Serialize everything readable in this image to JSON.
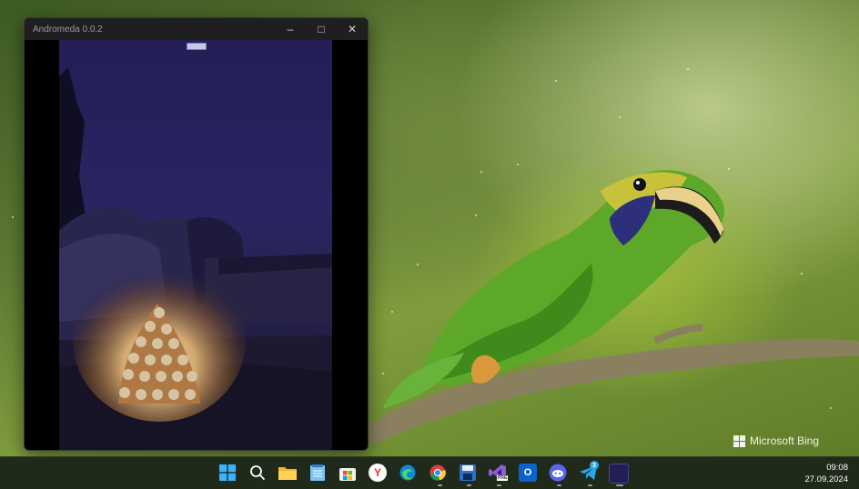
{
  "window": {
    "title": "Andromeda 0.0.2",
    "minimize_label": "–",
    "maximize_label": "□",
    "close_label": "✕"
  },
  "wallpaper": {
    "brand_text": "Microsoft Bing"
  },
  "taskbar": {
    "pinned": [
      {
        "name": "start-button",
        "icon": "windows-logo-icon"
      },
      {
        "name": "search-button",
        "icon": "search-icon"
      },
      {
        "name": "file-explorer-button",
        "icon": "folder-icon"
      },
      {
        "name": "notepad-button",
        "icon": "notepad-icon"
      },
      {
        "name": "microsoft-store-button",
        "icon": "store-icon"
      },
      {
        "name": "yandex-browser-button",
        "icon": "yandex-icon",
        "glyph": "Y"
      },
      {
        "name": "edge-button",
        "icon": "edge-icon"
      },
      {
        "name": "chrome-button",
        "icon": "chrome-icon"
      },
      {
        "name": "save-app-button",
        "icon": "floppy-disk-icon"
      },
      {
        "name": "visual-studio-button",
        "icon": "visual-studio-icon",
        "badge": "PRE"
      },
      {
        "name": "outlook-button",
        "icon": "outlook-icon",
        "glyph": "O"
      },
      {
        "name": "discord-button",
        "icon": "discord-icon"
      },
      {
        "name": "telegram-button",
        "icon": "telegram-icon",
        "badge_count": "3"
      },
      {
        "name": "andromeda-button",
        "icon": "andromeda-app-icon"
      }
    ],
    "time": "09:08",
    "date": "27.09.2024"
  },
  "colors": {
    "taskbar_bg": "#202a1a",
    "titlebar_bg": "#1f1f1f",
    "night_sky": "#26215a",
    "lantern_glow": "#f3c47a"
  }
}
